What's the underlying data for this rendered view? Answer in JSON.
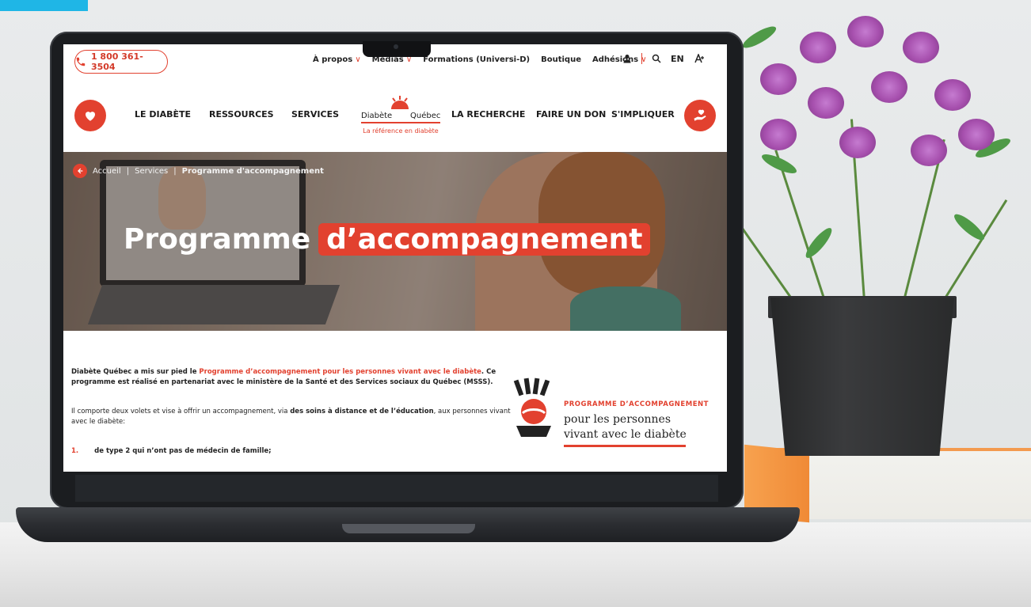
{
  "header": {
    "phone": "1 800 361-3504",
    "links": [
      {
        "label": "À propos",
        "dropdown": true
      },
      {
        "label": "Médias",
        "dropdown": true
      },
      {
        "label": "Formations (Universi-D)",
        "dropdown": false
      },
      {
        "label": "Boutique",
        "dropdown": false
      },
      {
        "label": "Adhésions",
        "dropdown": true
      }
    ],
    "lang": "EN",
    "icons": [
      "user-icon",
      "search-icon",
      "accessibility-icon"
    ]
  },
  "nav": {
    "items_left": [
      "LE DIABÈTE",
      "RESSOURCES",
      "SERVICES"
    ],
    "items_right": [
      "LA RECHERCHE",
      "FAIRE UN DON",
      "S'IMPLIQUER"
    ],
    "logo_left": "Diabète",
    "logo_right": "Québec",
    "logo_tagline": "La référence en diabète"
  },
  "breadcrumb": {
    "home": "Accueil",
    "section": "Services",
    "current": "Programme d'accompagnement"
  },
  "hero": {
    "title_plain": "Programme",
    "title_highlight": "d’accompagnement"
  },
  "content": {
    "p1_pre": "Diabète Québec a mis sur pied le ",
    "p1_link": "Programme d’accompagnement pour les personnes vivant avec le diabète",
    "p1_post": ". Ce programme est réalisé en partenariat avec le ministère de la Santé et des Services sociaux du Québec (MSSS).",
    "p2_pre": "Il comporte deux volets et vise à offrir un accompagnement, via ",
    "p2_bold": "des soins à distance et de l’éducation",
    "p2_post": ", aux personnes vivant avec le diabète:",
    "list": [
      {
        "num": "1.",
        "text": "de type 2 qui n’ont pas de médecin de famille;"
      }
    ]
  },
  "program_badge": {
    "title": "PROGRAMME D’ACCOMPAGNEMENT",
    "line1": "pour les personnes",
    "line2": "vivant avec le diabète"
  },
  "colors": {
    "brand_red": "#e2412f",
    "corner_tab": "#1fb6e6"
  }
}
